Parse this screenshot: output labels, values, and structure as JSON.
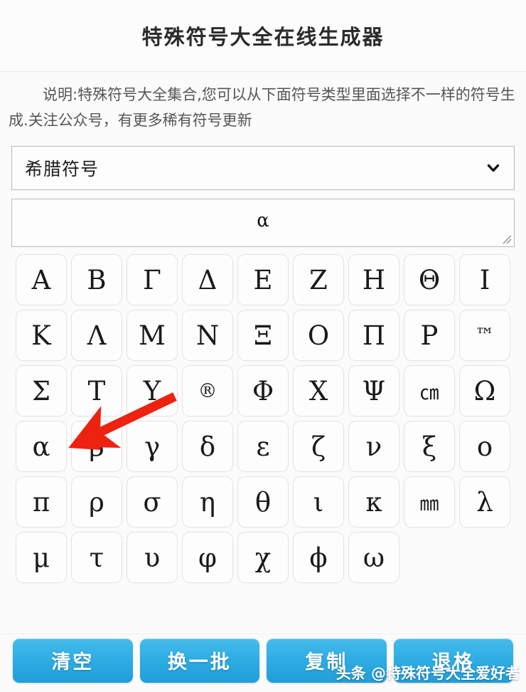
{
  "header": {
    "title": "特殊符号大全在线生成器"
  },
  "description": {
    "text": "说明:特殊符号大全集合,您可以从下面符号类型里面选择不一样的符号生成.关注公众号，有更多稀有符号更新"
  },
  "category_select": {
    "selected": "希腊符号",
    "chevron_icon": "chevron-down-icon"
  },
  "output": {
    "value": "α",
    "placeholder": "",
    "resize_handle_icon": "resize-grip-icon"
  },
  "symbol_grid": {
    "rows": [
      [
        "Α",
        "Β",
        "Γ",
        "Δ",
        "Ε",
        "Ζ",
        "Η",
        "Θ",
        "Ι"
      ],
      [
        "Κ",
        "Λ",
        "Μ",
        "Ν",
        "Ξ",
        "Ο",
        "Π",
        "Ρ",
        "™"
      ],
      [
        "Σ",
        "Τ",
        "Υ",
        "®",
        "Φ",
        "Χ",
        "Ψ",
        "㎝",
        "Ω"
      ],
      [
        "α",
        "β",
        "γ",
        "δ",
        "ε",
        "ζ",
        "ν",
        "ξ",
        "ο"
      ],
      [
        "π",
        "ρ",
        "σ",
        "η",
        "θ",
        "ι",
        "κ",
        "㎜",
        "λ"
      ],
      [
        "μ",
        "τ",
        "υ",
        "φ",
        "χ",
        "ϕ",
        "ω"
      ]
    ],
    "small_symbols": [
      "™",
      "㎝",
      "㎜",
      "®"
    ]
  },
  "annotation": {
    "arrow_icon": "red-arrow-icon",
    "arrow_color": "#ee2211",
    "points_to": "α"
  },
  "footer": {
    "buttons": [
      {
        "label": "清空",
        "name": "clear-button"
      },
      {
        "label": "换一批",
        "name": "shuffle-button"
      },
      {
        "label": "复制",
        "name": "copy-button"
      },
      {
        "label": "退格",
        "name": "backspace-button"
      }
    ],
    "accent_color": "#2fade4"
  },
  "watermark": {
    "text": "头条 @特殊符号大全爱好者"
  }
}
